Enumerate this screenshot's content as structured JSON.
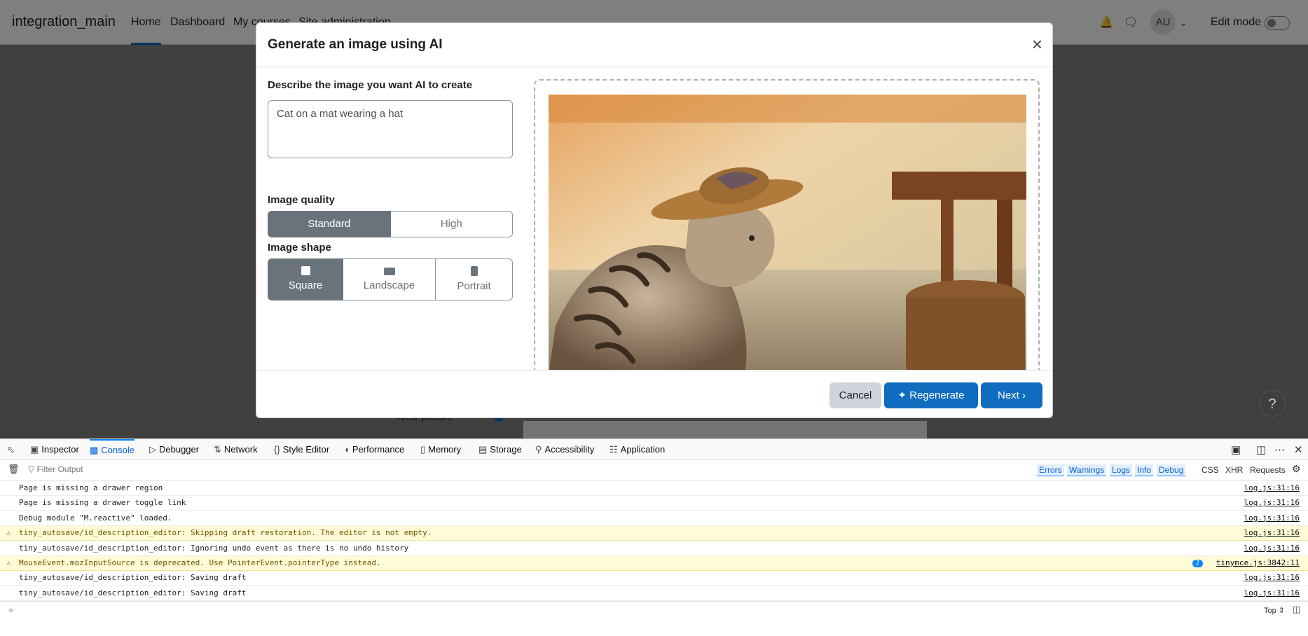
{
  "navbar": {
    "brand": "integration_main",
    "links": [
      "Home",
      "Dashboard",
      "My courses",
      "Site administration"
    ],
    "avatar": "AU",
    "edit_mode": "Edit mode"
  },
  "background": {
    "new_picture_label": "New picture"
  },
  "modal": {
    "title": "Generate an image using AI",
    "prompt_label": "Describe the image you want AI to create",
    "prompt_value": "Cat on a mat wearing a hat",
    "quality_label": "Image quality",
    "quality_options": [
      "Standard",
      "High"
    ],
    "quality_selected": "Standard",
    "shape_label": "Image shape",
    "shape_options": [
      "Square",
      "Landscape",
      "Portrait"
    ],
    "shape_selected": "Square",
    "buttons": {
      "cancel": "Cancel",
      "regenerate": "Regenerate",
      "next": "Next"
    }
  },
  "devtools": {
    "tabs": [
      "Inspector",
      "Console",
      "Debugger",
      "Network",
      "Style Editor",
      "Performance",
      "Memory",
      "Storage",
      "Accessibility",
      "Application"
    ],
    "active_tab": "Console",
    "filter_placeholder": "Filter Output",
    "filter_buttons": [
      "Errors",
      "Warnings",
      "Logs",
      "Info",
      "Debug"
    ],
    "filter_extra": [
      "CSS",
      "XHR",
      "Requests"
    ],
    "context": "Top",
    "logs": [
      {
        "level": "log",
        "message": "Page is missing a drawer region",
        "source": "log.js:31:16"
      },
      {
        "level": "log",
        "message": "Page is missing a drawer toggle link",
        "source": "log.js:31:16"
      },
      {
        "level": "log",
        "message": "Debug module \"M.reactive\" loaded.",
        "source": "log.js:31:16"
      },
      {
        "level": "warn",
        "message": "tiny_autosave/id_description_editor: Skipping draft restoration. The editor is not empty.",
        "source": "log.js:31:16"
      },
      {
        "level": "log",
        "message": "tiny_autosave/id_description_editor: Ignoring undo event as there is no undo history",
        "source": "log.js:31:16"
      },
      {
        "level": "warn",
        "message": "MouseEvent.mozInputSource is deprecated. Use PointerEvent.pointerType instead.",
        "source": "tinymce.js:3842:11",
        "count": "2"
      },
      {
        "level": "log",
        "message": "tiny_autosave/id_description_editor: Saving draft",
        "source": "log.js:31:16"
      },
      {
        "level": "log",
        "message": "tiny_autosave/id_description_editor: Saving draft",
        "source": "log.js:31:16"
      }
    ]
  },
  "colors": {
    "primary": "#0f6cbf",
    "secondary": "#6a737b",
    "warning_bg": "#fffbd6"
  }
}
